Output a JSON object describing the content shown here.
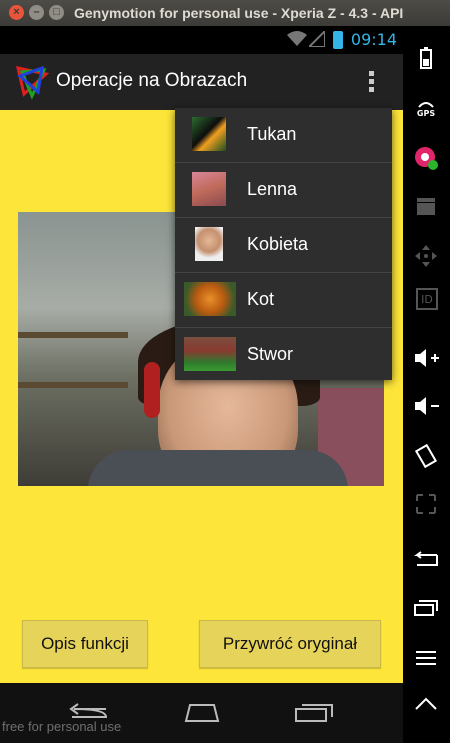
{
  "window": {
    "title": "Genymotion for personal use - Xperia Z - 4.3 - API"
  },
  "status_bar": {
    "time": "09:14",
    "accent_color": "#33b5e5"
  },
  "action_bar": {
    "title": "Operacje na Obrazach"
  },
  "menu": {
    "items": [
      {
        "label": "Tukan"
      },
      {
        "label": "Lenna"
      },
      {
        "label": "Kobieta"
      },
      {
        "label": "Kot"
      },
      {
        "label": "Stwor"
      }
    ]
  },
  "buttons": {
    "left": "Opis funkcji",
    "right": "Przywróć oryginał"
  },
  "sidebar": {
    "gps_label": "GPS",
    "id_label": "ID"
  },
  "watermark": "free for personal use",
  "colors": {
    "background": "#fde53a",
    "button": "#e6d35a",
    "menu": "#2e2e2e"
  }
}
